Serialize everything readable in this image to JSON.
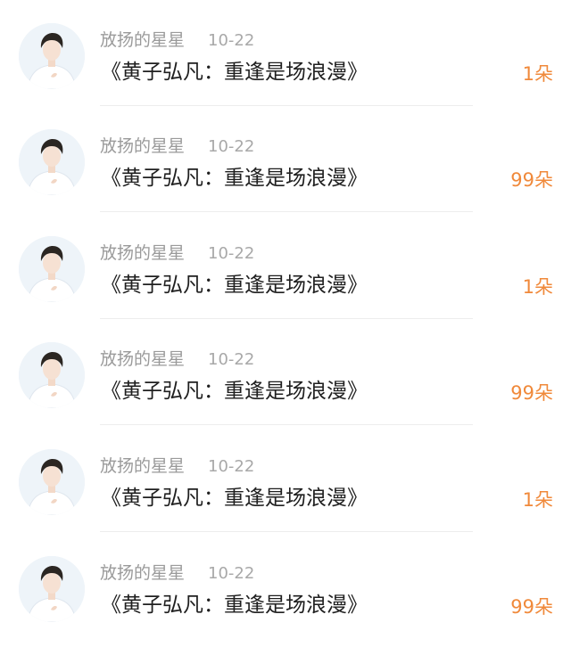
{
  "colors": {
    "count_accent": "#f0893a",
    "username": "#9a9a9a",
    "title": "#1f1f1f"
  },
  "items": [
    {
      "username": "放扬的星星",
      "date": "10-22",
      "title": "《黄子弘凡：重逢是场浪漫》",
      "count": "1朵",
      "avatar_icon": "user-avatar"
    },
    {
      "username": "放扬的星星",
      "date": "10-22",
      "title": "《黄子弘凡：重逢是场浪漫》",
      "count": "99朵",
      "avatar_icon": "user-avatar"
    },
    {
      "username": "放扬的星星",
      "date": "10-22",
      "title": "《黄子弘凡：重逢是场浪漫》",
      "count": "1朵",
      "avatar_icon": "user-avatar"
    },
    {
      "username": "放扬的星星",
      "date": "10-22",
      "title": "《黄子弘凡：重逢是场浪漫》",
      "count": "99朵",
      "avatar_icon": "user-avatar"
    },
    {
      "username": "放扬的星星",
      "date": "10-22",
      "title": "《黄子弘凡：重逢是场浪漫》",
      "count": "1朵",
      "avatar_icon": "user-avatar"
    },
    {
      "username": "放扬的星星",
      "date": "10-22",
      "title": "《黄子弘凡：重逢是场浪漫》",
      "count": "99朵",
      "avatar_icon": "user-avatar"
    }
  ]
}
